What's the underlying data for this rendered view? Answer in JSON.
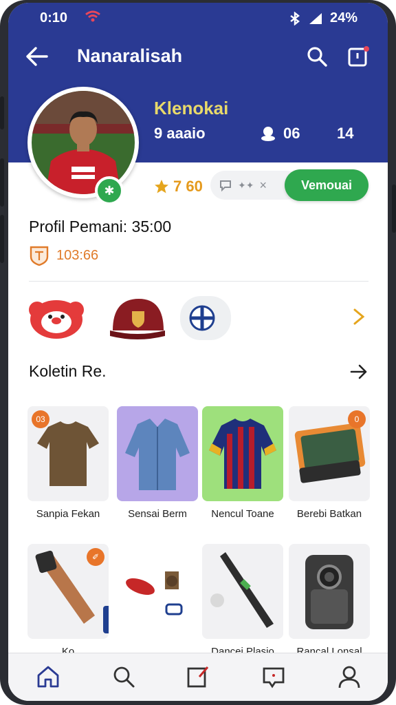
{
  "status": {
    "time": "0:10",
    "battery": "24%"
  },
  "topbar": {
    "title": "Nanaralisah"
  },
  "profile": {
    "username": "Klenokai",
    "stats": [
      "9 aaaio",
      "06",
      "14"
    ],
    "rating": "7 60",
    "follow_label": "Vemouai",
    "title": "Profil Pemani: 35:00",
    "subtitle": "103:66"
  },
  "collection": {
    "title": "Koletin Re.",
    "items": [
      {
        "label": "Sanpia Fekan",
        "tag": "03"
      },
      {
        "label": "Sensai Berm"
      },
      {
        "label": "Nencul Toane"
      },
      {
        "label": "Berebi Batkan",
        "tag": "0"
      },
      {
        "label": "Ko"
      },
      {
        "label": ""
      },
      {
        "label": "Dancei Plasio"
      },
      {
        "label": "Rancal Lonsal"
      }
    ]
  },
  "colors": {
    "header": "#2a3a93",
    "accent_green": "#2fa84f",
    "accent_orange": "#e8752a",
    "username": "#e8d96a"
  }
}
